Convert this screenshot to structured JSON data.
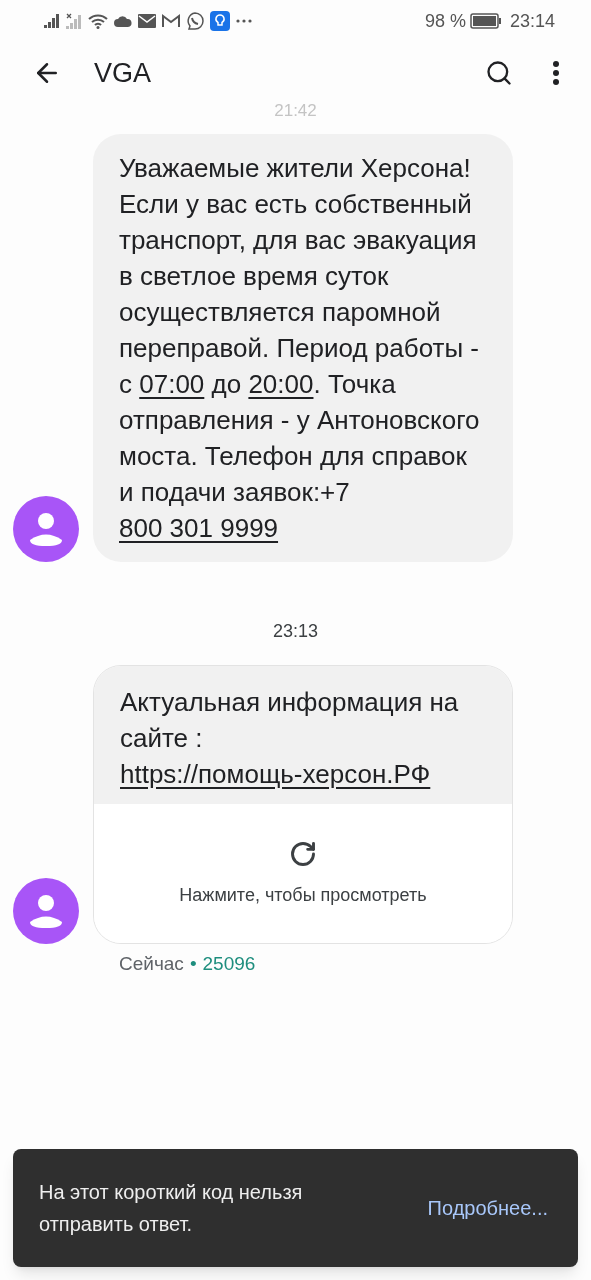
{
  "status_bar": {
    "battery_text": "98 %",
    "time": "23:14"
  },
  "app_bar": {
    "title": "VGA"
  },
  "faded_timestamp": "21:42",
  "messages": [
    {
      "parts": [
        {
          "text": "Уважаемые жители Херсона! Если у вас есть собственный транспорт, для вас эвакуация в светлое время суток осуществляется паромной переправой. Период работы - с ",
          "link": false
        },
        {
          "text": "07:00",
          "link": true
        },
        {
          "text": " до ",
          "link": false
        },
        {
          "text": "20:00",
          "link": true
        },
        {
          "text": ". Точка отправления - у Антоновского моста. Телефон для справок и подачи заявок:+7 ",
          "link": false
        },
        {
          "text": "800 301 9999",
          "link": true
        }
      ]
    },
    {
      "timestamp": "23:13",
      "parts": [
        {
          "text": "Актуальная информация на сайте : ",
          "link": false
        },
        {
          "text": "https://помощь-херсон.РФ",
          "link": true
        }
      ],
      "preview": {
        "label": "Нажмите, чтобы просмотреть"
      },
      "meta": {
        "time": "Сейчас",
        "separator": "•",
        "sender": "25096"
      }
    }
  ],
  "snackbar": {
    "message": "На этот короткий код нельзя отправить ответ.",
    "action": "Подробнее..."
  }
}
